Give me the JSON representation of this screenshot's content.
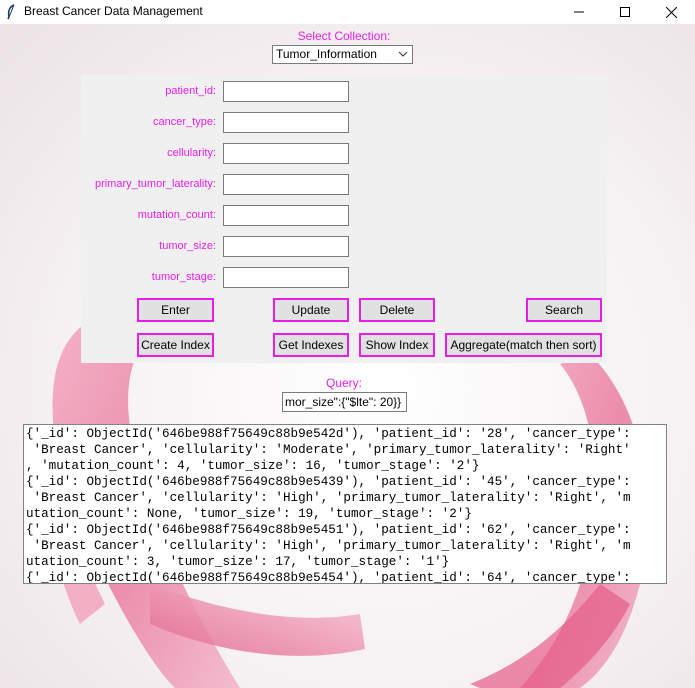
{
  "window": {
    "title": "Breast Cancer Data Management",
    "app_icon": "feather-icon",
    "controls": [
      "minimize-icon",
      "maximize-icon",
      "close-icon"
    ]
  },
  "theme": {
    "accent": "#e61ee6",
    "button_bg": "#e1e1e1",
    "panel_bg": "#f0f0f0",
    "ribbon": "#e8799d"
  },
  "collection": {
    "label": "Select Collection:",
    "selected": "Tumor_Information"
  },
  "fields": [
    {
      "label": "patient_id:",
      "value": ""
    },
    {
      "label": "cancer_type:",
      "value": ""
    },
    {
      "label": "cellularity:",
      "value": ""
    },
    {
      "label": "primary_tumor_laterality:",
      "value": ""
    },
    {
      "label": "mutation_count:",
      "value": ""
    },
    {
      "label": "tumor_size:",
      "value": ""
    },
    {
      "label": "tumor_stage:",
      "value": ""
    }
  ],
  "buttons": {
    "enter": "Enter",
    "update": "Update",
    "delete": "Delete",
    "search": "Search",
    "create_index": "Create Index",
    "get_indexes": "Get Indexes",
    "show_index": "Show Index",
    "aggregate": "Aggregate(match then sort)"
  },
  "query": {
    "label": "Query:",
    "value": "mor_size\":{\"$lte\": 20}}"
  },
  "results": {
    "lines": [
      "{'_id': ObjectId('646be988f75649c88b9e542d'), 'patient_id': '28', 'cancer_type':",
      " 'Breast Cancer', 'cellularity': 'Moderate', 'primary_tumor_laterality': 'Right'",
      ", 'mutation_count': 4, 'tumor_size': 16, 'tumor_stage': '2'}",
      "{'_id': ObjectId('646be988f75649c88b9e5439'), 'patient_id': '45', 'cancer_type':",
      " 'Breast Cancer', 'cellularity': 'High', 'primary_tumor_laterality': 'Right', 'm",
      "utation_count': None, 'tumor_size': 19, 'tumor_stage': '2'}",
      "{'_id': ObjectId('646be988f75649c88b9e5451'), 'patient_id': '62', 'cancer_type':",
      " 'Breast Cancer', 'cellularity': 'High', 'primary_tumor_laterality': 'Right', 'm",
      "utation_count': 3, 'tumor_size': 17, 'tumor_stage': '1'}",
      "{'_id': ObjectId('646be988f75649c88b9e5454'), 'patient_id': '64', 'cancer_type':"
    ]
  }
}
